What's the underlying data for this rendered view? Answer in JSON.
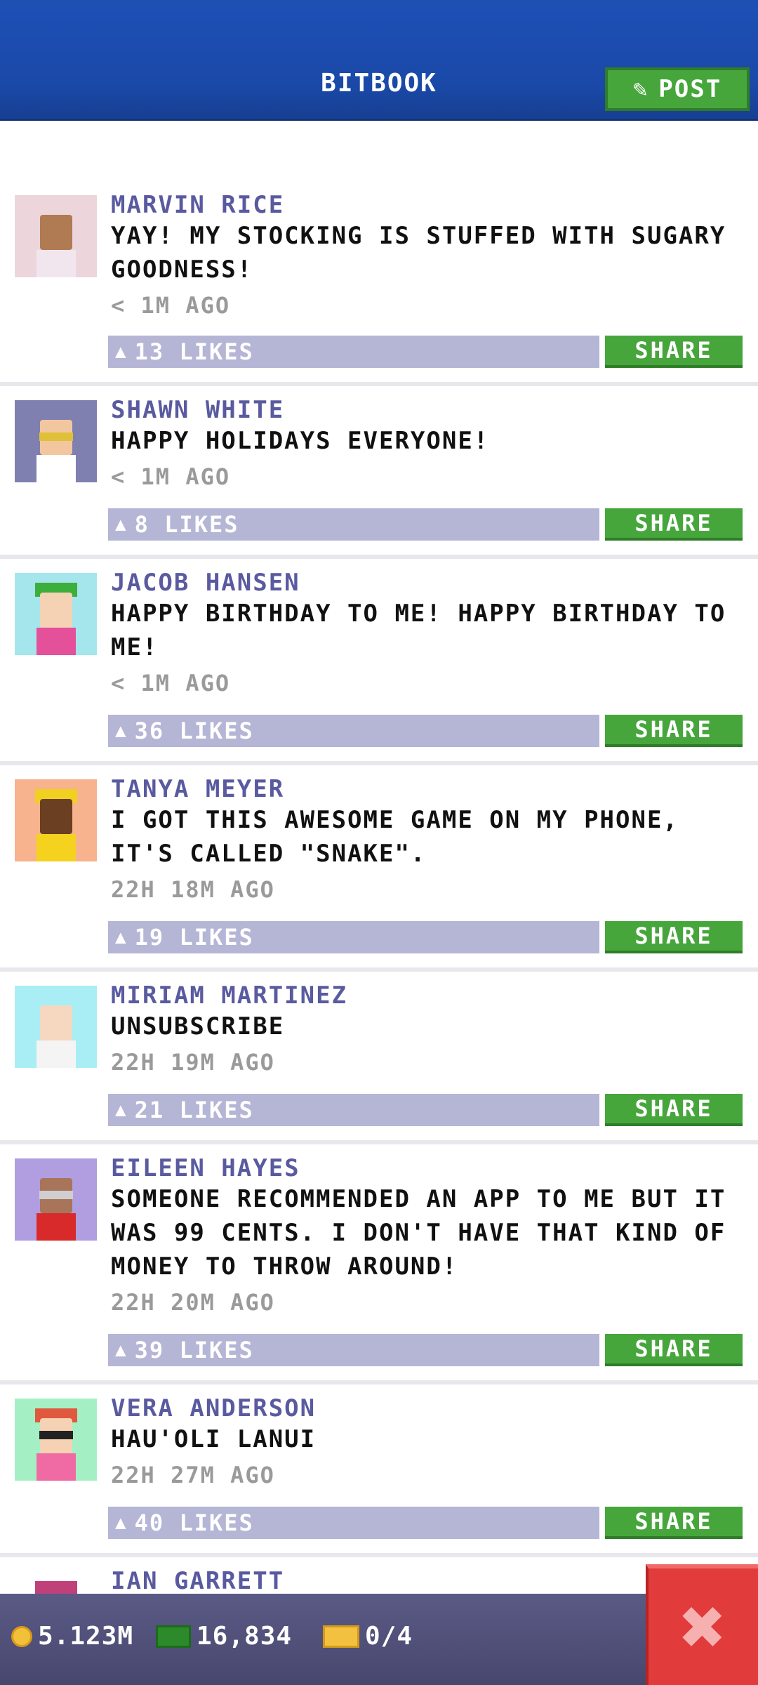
{
  "header": {
    "title": "BITBOOK",
    "post_label": "POST"
  },
  "posts": [
    {
      "name": "MARVIN RICE",
      "message": "YAY! MY STOCKING IS STUFFED WITH SUGARY GOODNESS!",
      "time": "< 1M AGO",
      "likes": "13 LIKES",
      "share_label": "SHARE"
    },
    {
      "name": "SHAWN WHITE",
      "message": "HAPPY HOLIDAYS EVERYONE!",
      "time": "< 1M AGO",
      "likes": "8 LIKES",
      "share_label": "SHARE"
    },
    {
      "name": "JACOB HANSEN",
      "message": "HAPPY BIRTHDAY TO ME! HAPPY BIRTHDAY TO ME!",
      "time": "< 1M AGO",
      "likes": "36 LIKES",
      "share_label": "SHARE"
    },
    {
      "name": "TANYA MEYER",
      "message": "I GOT THIS AWESOME GAME ON MY PHONE, IT'S CALLED \"SNAKE\".",
      "time": "22H 18M AGO",
      "likes": "19 LIKES",
      "share_label": "SHARE"
    },
    {
      "name": "MIRIAM MARTINEZ",
      "message": "UNSUBSCRIBE",
      "time": "22H 19M AGO",
      "likes": "21 LIKES",
      "share_label": "SHARE"
    },
    {
      "name": "EILEEN HAYES",
      "message": "SOMEONE RECOMMENDED AN APP TO ME BUT IT WAS 99 CENTS. I DON'T HAVE THAT KIND OF MONEY TO THROW AROUND!",
      "time": "22H 20M AGO",
      "likes": "39 LIKES",
      "share_label": "SHARE"
    },
    {
      "name": "VERA ANDERSON",
      "message": "HAU'OLI LANUI",
      "time": "22H 27M AGO",
      "likes": "40 LIKES",
      "share_label": "SHARE"
    },
    {
      "name": "IAN GARRETT",
      "message": "",
      "time": "",
      "likes": "",
      "share_label": ""
    }
  ],
  "footer": {
    "coins": "5.123M",
    "bux": "16,834",
    "tickets": "0/4"
  },
  "colors": {
    "header": "#1d4fb5",
    "accent_green": "#46a63c",
    "likes_bar": "#b5b5d6",
    "name": "#5a5aa0",
    "footer": "#4f4f7a",
    "close": "#e23b3b"
  },
  "icons": {
    "post": "edit-icon",
    "like": "thumbs-up-icon",
    "coin": "coin-icon",
    "bux": "cash-icon",
    "ticket": "ticket-icon",
    "close": "close-icon"
  }
}
